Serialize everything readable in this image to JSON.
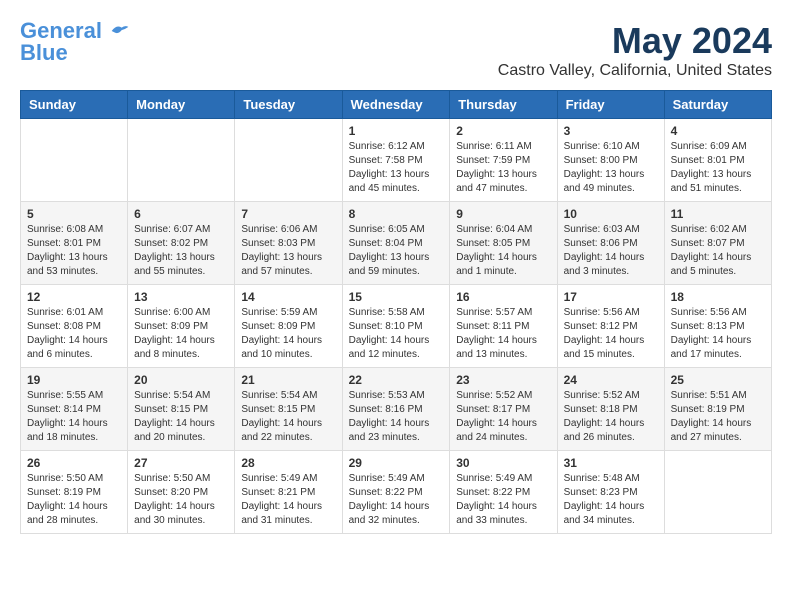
{
  "logo": {
    "text1": "General",
    "text2": "Blue"
  },
  "title": "May 2024",
  "location": "Castro Valley, California, United States",
  "days_of_week": [
    "Sunday",
    "Monday",
    "Tuesday",
    "Wednesday",
    "Thursday",
    "Friday",
    "Saturday"
  ],
  "weeks": [
    [
      {
        "day": "",
        "info": ""
      },
      {
        "day": "",
        "info": ""
      },
      {
        "day": "",
        "info": ""
      },
      {
        "day": "1",
        "info": "Sunrise: 6:12 AM\nSunset: 7:58 PM\nDaylight: 13 hours\nand 45 minutes."
      },
      {
        "day": "2",
        "info": "Sunrise: 6:11 AM\nSunset: 7:59 PM\nDaylight: 13 hours\nand 47 minutes."
      },
      {
        "day": "3",
        "info": "Sunrise: 6:10 AM\nSunset: 8:00 PM\nDaylight: 13 hours\nand 49 minutes."
      },
      {
        "day": "4",
        "info": "Sunrise: 6:09 AM\nSunset: 8:01 PM\nDaylight: 13 hours\nand 51 minutes."
      }
    ],
    [
      {
        "day": "5",
        "info": "Sunrise: 6:08 AM\nSunset: 8:01 PM\nDaylight: 13 hours\nand 53 minutes."
      },
      {
        "day": "6",
        "info": "Sunrise: 6:07 AM\nSunset: 8:02 PM\nDaylight: 13 hours\nand 55 minutes."
      },
      {
        "day": "7",
        "info": "Sunrise: 6:06 AM\nSunset: 8:03 PM\nDaylight: 13 hours\nand 57 minutes."
      },
      {
        "day": "8",
        "info": "Sunrise: 6:05 AM\nSunset: 8:04 PM\nDaylight: 13 hours\nand 59 minutes."
      },
      {
        "day": "9",
        "info": "Sunrise: 6:04 AM\nSunset: 8:05 PM\nDaylight: 14 hours\nand 1 minute."
      },
      {
        "day": "10",
        "info": "Sunrise: 6:03 AM\nSunset: 8:06 PM\nDaylight: 14 hours\nand 3 minutes."
      },
      {
        "day": "11",
        "info": "Sunrise: 6:02 AM\nSunset: 8:07 PM\nDaylight: 14 hours\nand 5 minutes."
      }
    ],
    [
      {
        "day": "12",
        "info": "Sunrise: 6:01 AM\nSunset: 8:08 PM\nDaylight: 14 hours\nand 6 minutes."
      },
      {
        "day": "13",
        "info": "Sunrise: 6:00 AM\nSunset: 8:09 PM\nDaylight: 14 hours\nand 8 minutes."
      },
      {
        "day": "14",
        "info": "Sunrise: 5:59 AM\nSunset: 8:09 PM\nDaylight: 14 hours\nand 10 minutes."
      },
      {
        "day": "15",
        "info": "Sunrise: 5:58 AM\nSunset: 8:10 PM\nDaylight: 14 hours\nand 12 minutes."
      },
      {
        "day": "16",
        "info": "Sunrise: 5:57 AM\nSunset: 8:11 PM\nDaylight: 14 hours\nand 13 minutes."
      },
      {
        "day": "17",
        "info": "Sunrise: 5:56 AM\nSunset: 8:12 PM\nDaylight: 14 hours\nand 15 minutes."
      },
      {
        "day": "18",
        "info": "Sunrise: 5:56 AM\nSunset: 8:13 PM\nDaylight: 14 hours\nand 17 minutes."
      }
    ],
    [
      {
        "day": "19",
        "info": "Sunrise: 5:55 AM\nSunset: 8:14 PM\nDaylight: 14 hours\nand 18 minutes."
      },
      {
        "day": "20",
        "info": "Sunrise: 5:54 AM\nSunset: 8:15 PM\nDaylight: 14 hours\nand 20 minutes."
      },
      {
        "day": "21",
        "info": "Sunrise: 5:54 AM\nSunset: 8:15 PM\nDaylight: 14 hours\nand 22 minutes."
      },
      {
        "day": "22",
        "info": "Sunrise: 5:53 AM\nSunset: 8:16 PM\nDaylight: 14 hours\nand 23 minutes."
      },
      {
        "day": "23",
        "info": "Sunrise: 5:52 AM\nSunset: 8:17 PM\nDaylight: 14 hours\nand 24 minutes."
      },
      {
        "day": "24",
        "info": "Sunrise: 5:52 AM\nSunset: 8:18 PM\nDaylight: 14 hours\nand 26 minutes."
      },
      {
        "day": "25",
        "info": "Sunrise: 5:51 AM\nSunset: 8:19 PM\nDaylight: 14 hours\nand 27 minutes."
      }
    ],
    [
      {
        "day": "26",
        "info": "Sunrise: 5:50 AM\nSunset: 8:19 PM\nDaylight: 14 hours\nand 28 minutes."
      },
      {
        "day": "27",
        "info": "Sunrise: 5:50 AM\nSunset: 8:20 PM\nDaylight: 14 hours\nand 30 minutes."
      },
      {
        "day": "28",
        "info": "Sunrise: 5:49 AM\nSunset: 8:21 PM\nDaylight: 14 hours\nand 31 minutes."
      },
      {
        "day": "29",
        "info": "Sunrise: 5:49 AM\nSunset: 8:22 PM\nDaylight: 14 hours\nand 32 minutes."
      },
      {
        "day": "30",
        "info": "Sunrise: 5:49 AM\nSunset: 8:22 PM\nDaylight: 14 hours\nand 33 minutes."
      },
      {
        "day": "31",
        "info": "Sunrise: 5:48 AM\nSunset: 8:23 PM\nDaylight: 14 hours\nand 34 minutes."
      },
      {
        "day": "",
        "info": ""
      }
    ]
  ]
}
